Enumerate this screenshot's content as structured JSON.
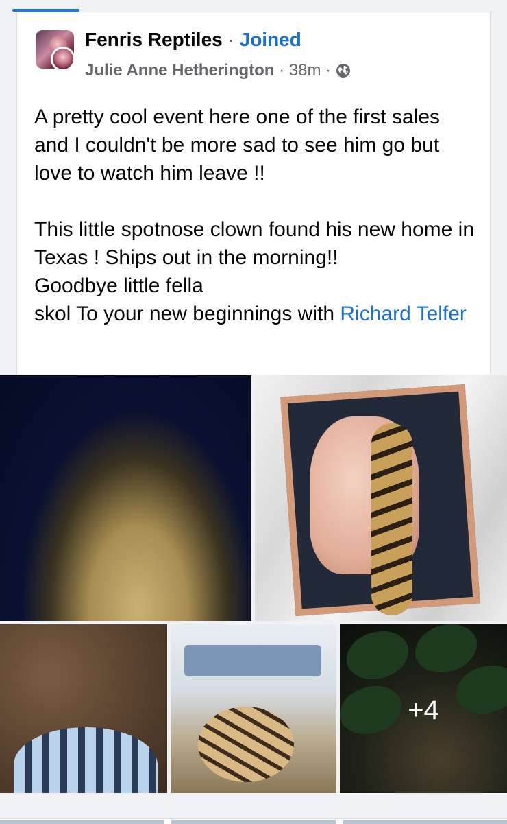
{
  "post": {
    "group_name": "Fenris Reptiles",
    "separator": "·",
    "joined_label": "Joined",
    "author": "Julie Anne Hetherington",
    "time": "38m",
    "time_separator": "·",
    "privacy_icon": "globe-icon",
    "paragraph1": "A pretty cool event here one of the first sales and I couldn't be more sad to see him go but love to watch him leave !!",
    "paragraph2_line1": "This little spotnose clown found his new home in Texas ! Ships out in the morning!!",
    "paragraph2_line2": "Goodbye little fella",
    "paragraph2_line3_prefix": " skol To your new beginnings with ",
    "mention": "Richard Telfer"
  },
  "photos": {
    "more_count": "+4"
  },
  "colors": {
    "accent": "#1870d5",
    "text": "#050505",
    "secondary": "#65676b",
    "background": "#f0f2f5"
  }
}
